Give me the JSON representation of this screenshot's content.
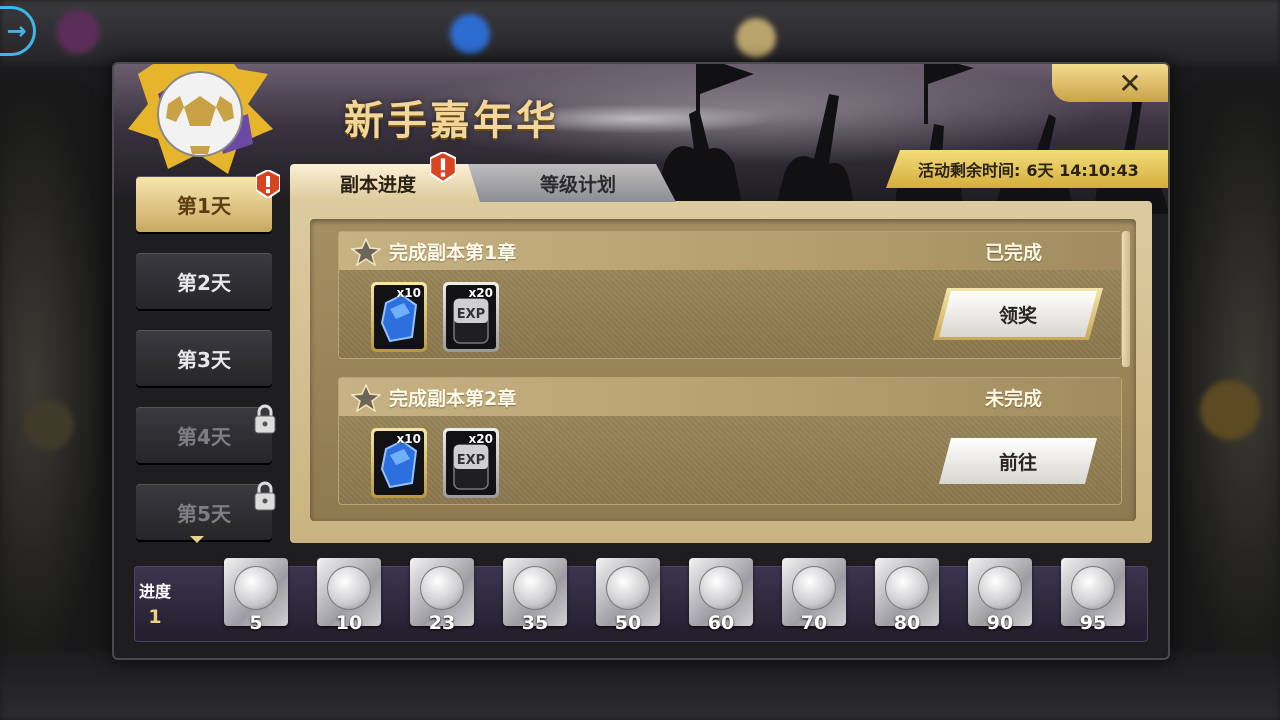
{
  "title": "新手嘉年华",
  "close_label": "✕",
  "timer": {
    "label": "活动剩余时间:",
    "value": "6天 14:10:43"
  },
  "days": [
    {
      "label": "第1天",
      "state": "active",
      "alert": true
    },
    {
      "label": "第2天",
      "state": "normal"
    },
    {
      "label": "第3天",
      "state": "normal"
    },
    {
      "label": "第4天",
      "state": "locked"
    },
    {
      "label": "第5天",
      "state": "locked"
    }
  ],
  "tabs": {
    "active": "副本进度",
    "inactive": "等级计划"
  },
  "tasks": [
    {
      "title": "完成副本第1章",
      "status": "已完成",
      "button": "领奖",
      "rewards": [
        {
          "icon": "blue-gem-icon",
          "count": "x10"
        },
        {
          "icon": "exp-card-icon",
          "count": "x20"
        }
      ]
    },
    {
      "title": "完成副本第2章",
      "status": "未完成",
      "button": "前往",
      "rewards": [
        {
          "icon": "blue-gem-icon",
          "count": "x10"
        },
        {
          "icon": "exp-card-icon",
          "count": "x20"
        }
      ]
    }
  ],
  "progress": {
    "label": "进度",
    "value": "1",
    "milestones": [
      "5",
      "10",
      "23",
      "35",
      "50",
      "60",
      "70",
      "80",
      "90",
      "95"
    ]
  },
  "colors": {
    "accent_gold": "#f3d79a",
    "timer_bg": "#e4c456",
    "progress_bg": "#2e2840"
  }
}
